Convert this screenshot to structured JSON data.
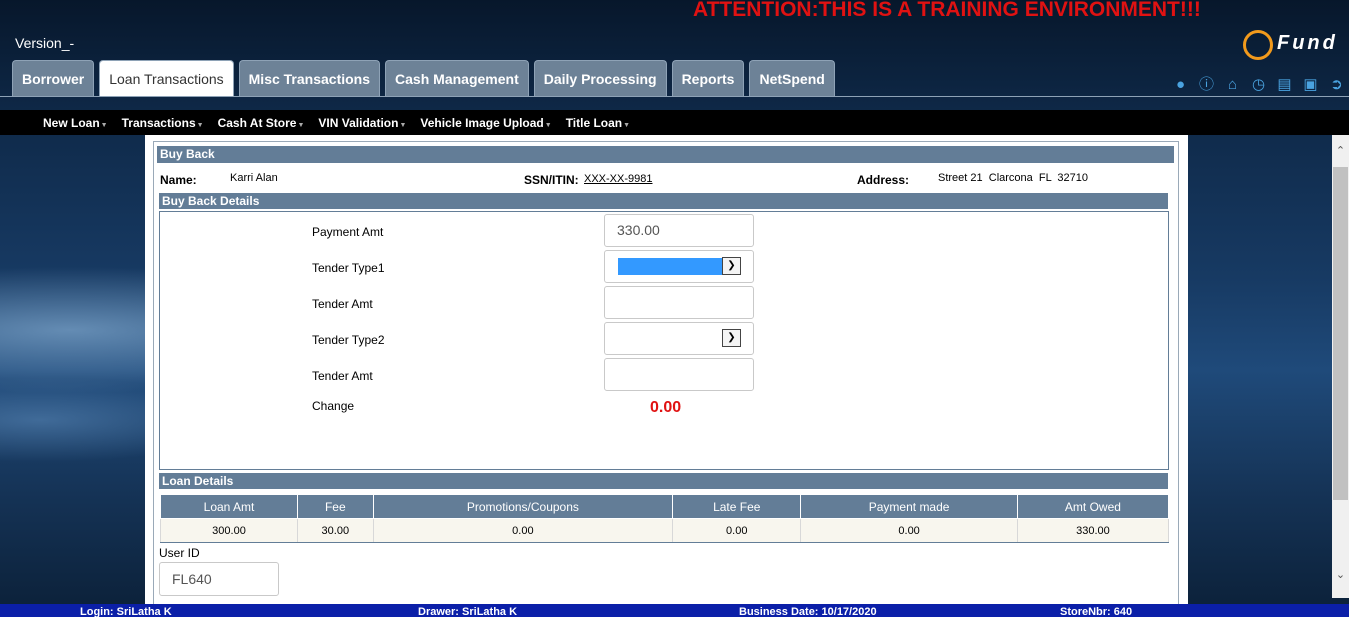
{
  "banner": {
    "attention": "ATTENTION:THIS IS A TRAINING ENVIRONMENT!!!"
  },
  "version": "Version_-",
  "logo": {
    "text": "Fund"
  },
  "tabs": [
    {
      "label": "Borrower"
    },
    {
      "label": "Loan Transactions",
      "active": true
    },
    {
      "label": "Misc Transactions"
    },
    {
      "label": "Cash Management"
    },
    {
      "label": "Daily Processing"
    },
    {
      "label": "Reports"
    },
    {
      "label": "NetSpend"
    }
  ],
  "header_icons": [
    "user-icon",
    "info-icon",
    "home-icon",
    "clock-icon",
    "list-icon",
    "lock-icon",
    "logout-icon"
  ],
  "subnav": [
    {
      "label": "New Loan"
    },
    {
      "label": "Transactions"
    },
    {
      "label": "Cash At Store"
    },
    {
      "label": "VIN Validation"
    },
    {
      "label": "Vehicle Image Upload"
    },
    {
      "label": "Title Loan"
    }
  ],
  "buy_back": {
    "title": "Buy Back",
    "name_label": "Name:",
    "name_value": "Karri Alan",
    "ssn_label": "SSN/ITIN:",
    "ssn_value": "XXX-XX-9981",
    "address_label": "Address:",
    "address_value": "Street 21  Clarcona  FL  32710"
  },
  "details": {
    "title": "Buy Back Details",
    "payment_amt_label": "Payment Amt",
    "payment_amt_value": "330.00",
    "tender_type1_label": "Tender Type1",
    "tender_amt1_label": "Tender Amt",
    "tender_type2_label": "Tender Type2",
    "tender_amt2_label": "Tender Amt",
    "change_label": "Change",
    "change_value": "0.00"
  },
  "loan_details": {
    "title": "Loan Details",
    "headers": [
      "Loan Amt",
      "Fee",
      "Promotions/Coupons",
      "Late Fee",
      "Payment made",
      "Amt Owed"
    ],
    "row": [
      "300.00",
      "30.00",
      "0.00",
      "0.00",
      "0.00",
      "330.00"
    ]
  },
  "user": {
    "label": "User ID",
    "value": "FL640"
  },
  "footer": {
    "login": "Login: SriLatha K",
    "drawer": "Drawer: SriLatha K",
    "business_date": "Business Date: 10/17/2020",
    "store": "StoreNbr: 640"
  },
  "colors": {
    "attention": "#e01212",
    "section_header": "#637d97",
    "footer": "#0b1fa8",
    "accent_icon": "#4aa3e0",
    "change": "#e01212"
  }
}
